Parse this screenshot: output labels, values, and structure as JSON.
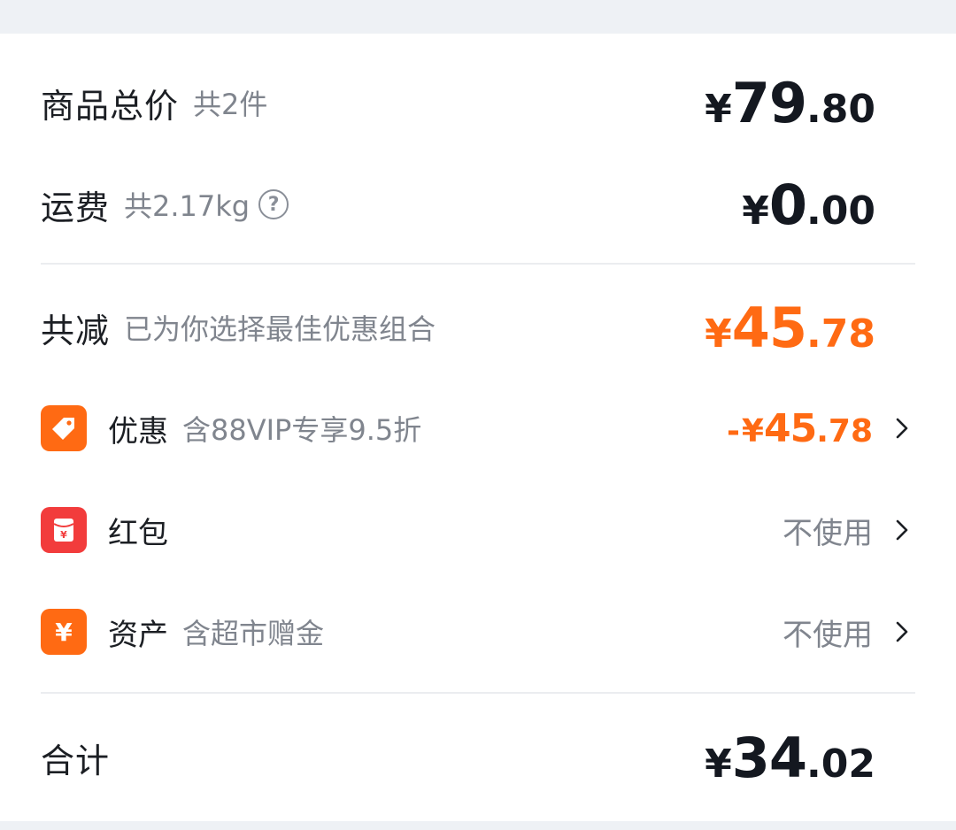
{
  "summary": {
    "goods_total": {
      "label": "商品总价",
      "note": "共2件",
      "currency": "¥",
      "integer": "79",
      "decimal": ".80"
    },
    "shipping": {
      "label": "运费",
      "note": "共2.17kg",
      "help_glyph": "?",
      "currency": "¥",
      "integer": "0",
      "decimal": ".00"
    },
    "total_reduction": {
      "label": "共减",
      "note": "已为你选择最佳优惠组合",
      "currency": "¥",
      "integer": "45",
      "decimal": ".78"
    }
  },
  "items": {
    "discount": {
      "label": "优惠",
      "note": "含88VIP专享9.5折",
      "neg": "-",
      "currency": "¥",
      "integer": "45",
      "decimal": ".78",
      "icon": "tag-icon"
    },
    "red_packet": {
      "label": "红包",
      "value": "不使用",
      "icon": "red-packet-icon"
    },
    "assets": {
      "label": "资产",
      "note": "含超市赠金",
      "value": "不使用",
      "icon": "yen-icon"
    }
  },
  "total": {
    "label": "合计",
    "currency": "¥",
    "integer": "34",
    "decimal": ".02"
  },
  "colors": {
    "accent_orange": "#ff6a13",
    "red_badge": "#f23c3c",
    "text_dark": "#141820",
    "text_gray": "#80858e"
  }
}
